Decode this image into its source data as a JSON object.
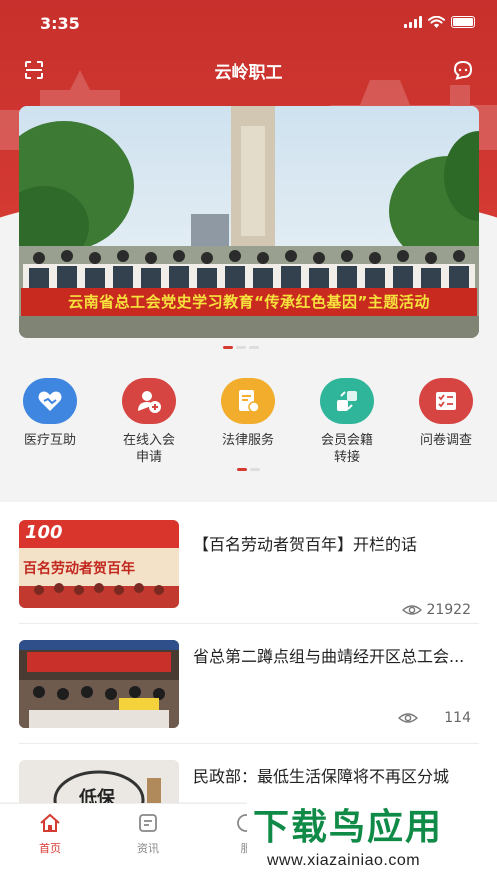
{
  "status_bar": {
    "time": "3:35"
  },
  "nav": {
    "title": "云岭职工",
    "scan_icon": "scan-icon",
    "chat_icon": "chat-icon"
  },
  "banner": {
    "caption": "云南省总工会党史学习教育“传承红色基因”主题活动",
    "slide_index": 1,
    "slide_count": 3
  },
  "quick_menu": {
    "items": [
      {
        "label": "医疗互助",
        "icon": "handshake-heart-icon",
        "color": "#3f86e0"
      },
      {
        "label": "在线入会申请",
        "label_line1": "在线入会",
        "label_line2": "申请",
        "icon": "add-member-icon",
        "color": "#d64541"
      },
      {
        "label": "法律服务",
        "icon": "legal-document-icon",
        "color": "#f1ad2b"
      },
      {
        "label": "会员会籍转接",
        "label_line1": "会员会籍",
        "label_line2": "转接",
        "icon": "transfer-icon",
        "color": "#2fb59a"
      },
      {
        "label": "问卷调查",
        "icon": "checklist-icon",
        "color": "#d64541"
      }
    ],
    "page_index": 1,
    "page_count": 2
  },
  "news": [
    {
      "title": "【百名劳动者贺百年】开栏的话",
      "views": "21922",
      "thumb_text": "百名劳动者贺百年",
      "thumb_badge": "100"
    },
    {
      "title": "省总第二蹲点组与曲靖经开区总工会...",
      "views": "114"
    },
    {
      "title": "民政部：最低生活保障将不再区分城",
      "thumb_text": "低保"
    }
  ],
  "tab_bar": {
    "tabs": [
      {
        "label": "首页",
        "icon": "home-icon",
        "active": true
      },
      {
        "label": "资讯",
        "icon": "news-icon",
        "active": false
      },
      {
        "label": "服",
        "icon": "service-icon",
        "active": false
      }
    ]
  },
  "watermark": {
    "text": "下载鸟应用",
    "url": "www.xiazainiao.com"
  },
  "colors": {
    "brand_red": "#d63b32",
    "header_red": "#c7302c",
    "caption_yellow": "#f6e23c"
  }
}
